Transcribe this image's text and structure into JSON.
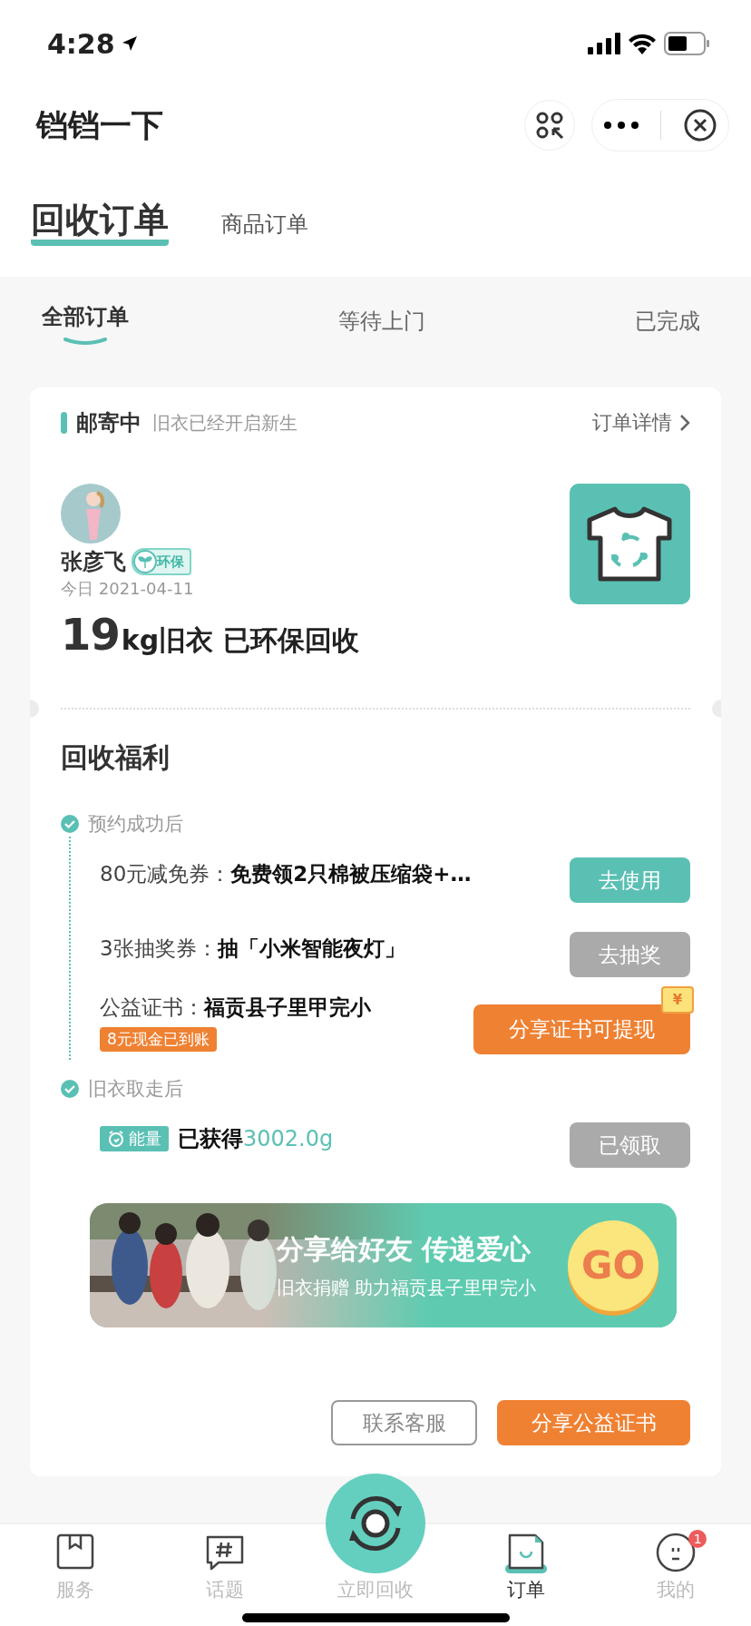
{
  "status_bar": {
    "time": "4:28"
  },
  "header": {
    "title": "铛铛一下"
  },
  "tabs": [
    {
      "label": "回收订单",
      "selected": true
    },
    {
      "label": "商品订单",
      "selected": false
    }
  ],
  "filters": [
    {
      "label": "全部订单",
      "selected": true
    },
    {
      "label": "等待上门",
      "selected": false
    },
    {
      "label": "已完成",
      "selected": false
    }
  ],
  "order": {
    "status": "邮寄中",
    "status_note": "旧衣已经开启新生",
    "detail_link": "订单详情",
    "user": {
      "name": "张彦飞",
      "badge": "环保",
      "date": "今日 2021-04-11"
    },
    "weight": "19",
    "summary": "kg旧衣 已环保回收"
  },
  "benefits": {
    "title": "回收福利",
    "stages": [
      {
        "label": "预约成功后",
        "items": [
          {
            "kind": "coupon",
            "label": "80元减免券：",
            "value": "免费领2只棉被压缩袋+…",
            "button": {
              "label": "去使用",
              "kind": "primary"
            }
          },
          {
            "kind": "coupon",
            "label": "3张抽奖券：",
            "value": "抽「小米智能夜灯」",
            "button": {
              "label": "去抽奖",
              "kind": "muted"
            }
          },
          {
            "kind": "coupon",
            "label": "公益证书：",
            "value": "福贡县子里甲完小",
            "tag": "8元现金已到账",
            "button": {
              "label": "分享证书可提现",
              "kind": "accent",
              "ticket": "¥"
            }
          }
        ]
      },
      {
        "label": "旧衣取走后",
        "items": [
          {
            "kind": "energy",
            "tag": "能量",
            "label": "已获得",
            "value": "3002.0g",
            "button": {
              "label": "已领取",
              "kind": "muted"
            }
          }
        ]
      }
    ]
  },
  "banner": {
    "kind": "picture",
    "title": "分享给好友 传递爱心",
    "subtitle": "旧衣捐赠 助力福贡县子里甲完小",
    "go": "GO"
  },
  "actions": [
    {
      "label": "联系客服",
      "kind": "outline"
    },
    {
      "label": "分享公益证书",
      "kind": "accent"
    }
  ],
  "nav": [
    {
      "label": "服务",
      "kind": "service",
      "selected": false
    },
    {
      "label": "话题",
      "kind": "topic",
      "selected": false
    },
    {
      "label": "立即回收",
      "kind": "recycle",
      "selected": false
    },
    {
      "label": "订单",
      "kind": "orders",
      "selected": true
    },
    {
      "label": "我的",
      "kind": "me",
      "selected": false,
      "badge": "1"
    }
  ]
}
